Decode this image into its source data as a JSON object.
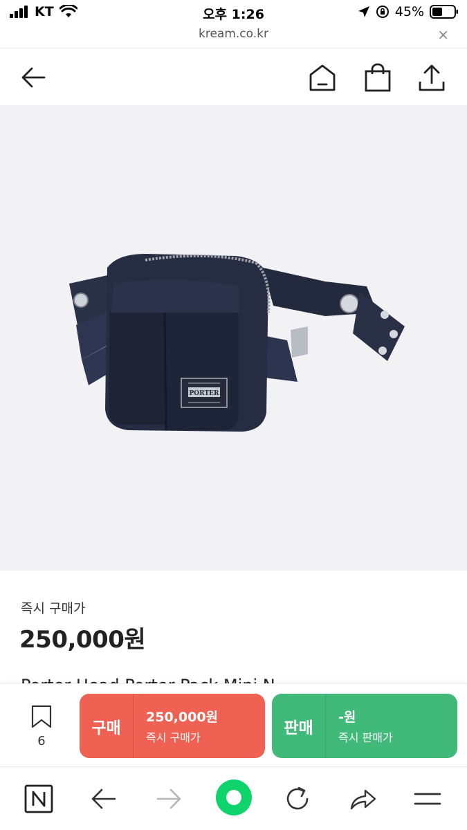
{
  "status_bar": {
    "carrier": "KT",
    "time": "오후 1:26",
    "battery": "45%"
  },
  "url_bar": {
    "url": "kream.co.kr",
    "close": "×"
  },
  "header": {
    "icons": [
      "back-arrow-icon",
      "home-icon",
      "shopping-bag-icon",
      "share-icon"
    ]
  },
  "product": {
    "image_alt": "Porter waist bag navy",
    "logo_text": "PORTER",
    "price_label": "즉시 구매가",
    "price": "250,000원",
    "name_peek": "Porter Head Porter Pack Mini N"
  },
  "action_bar": {
    "wish_count": "6",
    "buy": {
      "label": "구매",
      "price": "250,000원",
      "sub": "즉시 구매가",
      "color": "#ef6253"
    },
    "sell": {
      "label": "판매",
      "price": "-원",
      "sub": "즉시 판매가",
      "color": "#41b979"
    }
  },
  "browser_bar": {
    "icons": [
      "naver-n-icon",
      "back-icon",
      "forward-icon",
      "green-dot-icon",
      "refresh-icon",
      "share-arrow-icon",
      "menu-icon"
    ]
  }
}
